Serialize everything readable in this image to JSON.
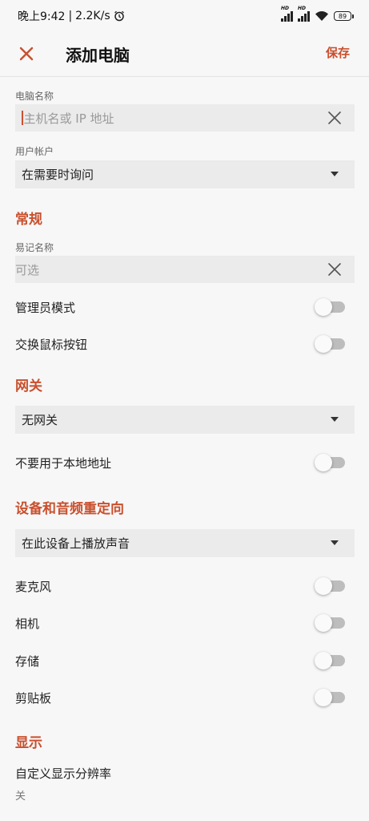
{
  "status": {
    "time": "晚上9:42",
    "speed": "2.2K/s",
    "hd1": "HD",
    "hd2": "HD",
    "battery": "89"
  },
  "appbar": {
    "title": "添加电脑",
    "save_label": "保存"
  },
  "computer_name": {
    "label": "电脑名称",
    "placeholder": "主机名或 IP 地址"
  },
  "user_account": {
    "label": "用户帐户",
    "value": "在需要时询问"
  },
  "general": {
    "title": "常规",
    "friendly_name": {
      "label": "易记名称",
      "placeholder": "可选"
    },
    "admin_mode": {
      "label": "管理员模式",
      "on": false
    },
    "swap_mouse": {
      "label": "交换鼠标按钮",
      "on": false
    }
  },
  "gateway": {
    "title": "网关",
    "value": "无网关",
    "bypass_local": {
      "label": "不要用于本地地址",
      "on": false
    }
  },
  "redirection": {
    "title": "设备和音频重定向",
    "audio_value": "在此设备上播放声音",
    "microphone": {
      "label": "麦克风",
      "on": false
    },
    "camera": {
      "label": "相机",
      "on": false
    },
    "storage": {
      "label": "存储",
      "on": false
    },
    "clipboard": {
      "label": "剪贴板",
      "on": false
    }
  },
  "display": {
    "title": "显示",
    "custom_resolution": {
      "label": "自定义显示分辨率",
      "value": "关"
    }
  },
  "colors": {
    "accent": "#c9502e",
    "field_bg": "#ebebeb",
    "toggle_off": "#bdbdbd"
  }
}
